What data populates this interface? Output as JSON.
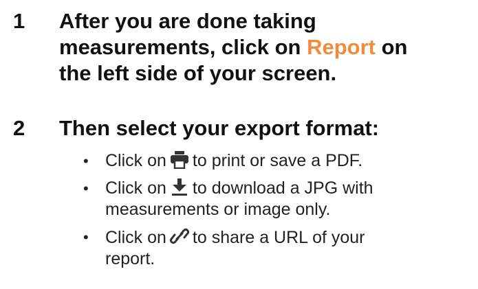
{
  "steps": [
    {
      "number": "1",
      "line1": "After you are done taking",
      "line2_pre": "measurements, click on ",
      "line2_highlight": "Report",
      "line2_post": " on",
      "line3": "the left side of your screen."
    },
    {
      "number": "2",
      "text": "Then select your export format:"
    }
  ],
  "bullets": [
    {
      "symbol": "•",
      "pre": "Click on",
      "icon": "print-icon",
      "line1": "to print or save a PDF."
    },
    {
      "symbol": "•",
      "pre": "Click on",
      "icon": "download-icon",
      "line1": "to download a JPG with",
      "line2": "measurements or image only."
    },
    {
      "symbol": "•",
      "pre": "Click on",
      "icon": "link-icon",
      "line1": "to share a URL of your",
      "line2": "report."
    }
  ],
  "colors": {
    "highlight": "#f08c3a",
    "text": "#111111",
    "icon": "#333333"
  }
}
